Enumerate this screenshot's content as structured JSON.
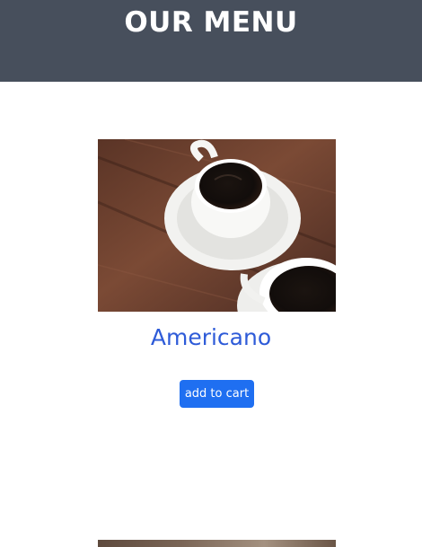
{
  "header": {
    "title": "OUR MENU"
  },
  "products": [
    {
      "name": "Americano",
      "image_icon": "coffee-cup-icon",
      "add_button_label": "add to cart"
    }
  ],
  "colors": {
    "header_bg": "#474f5c",
    "header_text": "#ffffff",
    "product_name": "#2e5bd8",
    "button_bg": "#1f6ff1",
    "button_text": "#ffffff"
  }
}
